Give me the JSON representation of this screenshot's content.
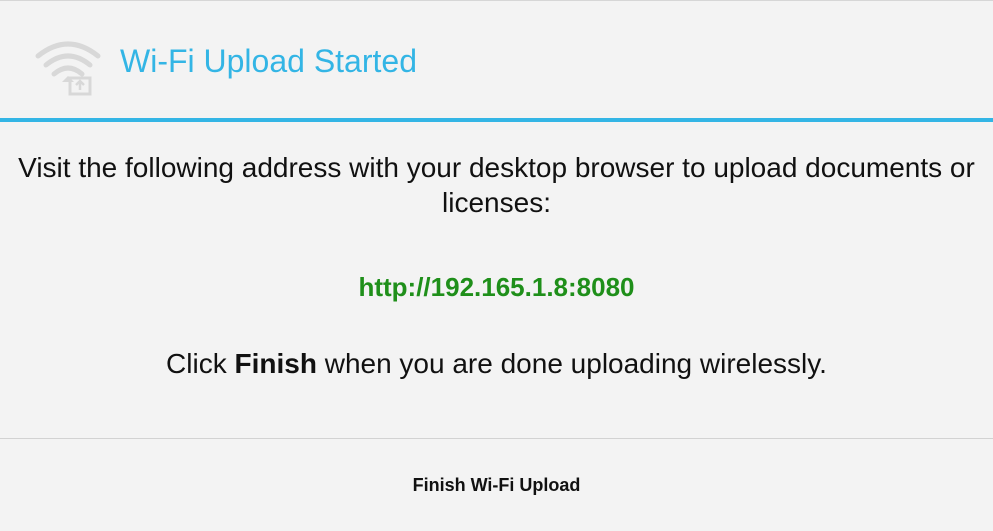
{
  "dialog": {
    "title": "Wi-Fi Upload Started",
    "title_icon": "wifi-upload-icon",
    "accent_color": "#33b5e5",
    "instructions": "Visit the following address with your desktop browser to upload documents or licenses:",
    "upload_url": "http://192.165.1.8:8080",
    "url_color": "#1f8f1a",
    "finish_note": {
      "prefix": "Click ",
      "emphasis": "Finish",
      "suffix": " when you are done uploading wirelessly."
    },
    "finish_button_label": "Finish Wi-Fi Upload"
  }
}
